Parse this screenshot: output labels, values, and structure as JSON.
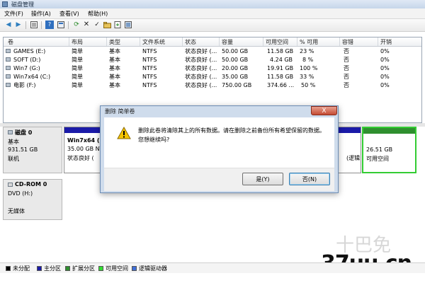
{
  "window": {
    "title": "磁盘管理"
  },
  "menu": [
    "文件(F)",
    "操作(A)",
    "查看(V)",
    "帮助(H)"
  ],
  "toolbar": {
    "icons": [
      "back-icon",
      "forward-icon",
      "properties-icon",
      "help-icon",
      "help-topic-icon",
      "refresh-icon",
      "delete-icon",
      "check-icon",
      "folder-icon",
      "new-icon",
      "settings-icon"
    ]
  },
  "volume_table": {
    "columns": [
      "卷",
      "布局",
      "类型",
      "文件系统",
      "状态",
      "容量",
      "可用空间",
      "% 可用",
      "容错",
      "开销"
    ],
    "rows": [
      [
        "GAMES (E:)",
        "简单",
        "基本",
        "NTFS",
        "状态良好 (...",
        "50.00 GB",
        "11.58 GB",
        "23 %",
        "否",
        "0%"
      ],
      [
        "SOFT (D:)",
        "简单",
        "基本",
        "NTFS",
        "状态良好 (...",
        "50.00 GB",
        "4.24 GB",
        "8 %",
        "否",
        "0%"
      ],
      [
        "Win7 (G:)",
        "简单",
        "基本",
        "NTFS",
        "状态良好 (...",
        "20.00 GB",
        "19.91 GB",
        "100 %",
        "否",
        "0%"
      ],
      [
        "Win7x64 (C:)",
        "简单",
        "基本",
        "NTFS",
        "状态良好 (...",
        "35.00 GB",
        "11.58 GB",
        "33 %",
        "否",
        "0%"
      ],
      [
        "电影 (F:)",
        "简单",
        "基本",
        "NTFS",
        "状态良好 (...",
        "750.00 GB",
        "374.66 ...",
        "50 %",
        "否",
        "0%"
      ]
    ]
  },
  "disks": [
    {
      "name": "磁盘 0",
      "type": "基本",
      "size": "931.51 GB",
      "status": "联机"
    },
    {
      "name": "CD-ROM 0",
      "type": "DVD (H:)",
      "status": "无媒体"
    }
  ],
  "partitions": {
    "c": {
      "name": "Win7x64  (C",
      "size": "35.00 GB NT",
      "status": "状态良好 ("
    },
    "mid": {
      "status": "(逻辑"
    },
    "unalloc": {
      "size": "26.51 GB",
      "status": "可用空间"
    }
  },
  "legend": [
    "未分配",
    "主分区",
    "扩展分区",
    "可用空间",
    "逻辑驱动器"
  ],
  "colors": {
    "unallocated": "#000000",
    "primary": "#1a1aa8",
    "extended": "#2f8f2f",
    "free": "#33dd33",
    "logical": "#3f6fd8"
  },
  "dialog": {
    "title": "删除 简单卷",
    "close": "X",
    "message": "删除此卷将清除其上的所有数据。请在删除之前备份所有希望保留的数据。您想继续吗?",
    "yes": "是(Y)",
    "no": "否(N)"
  },
  "watermark": {
    "brand": "十巴免",
    "site": "37uu.cn"
  }
}
